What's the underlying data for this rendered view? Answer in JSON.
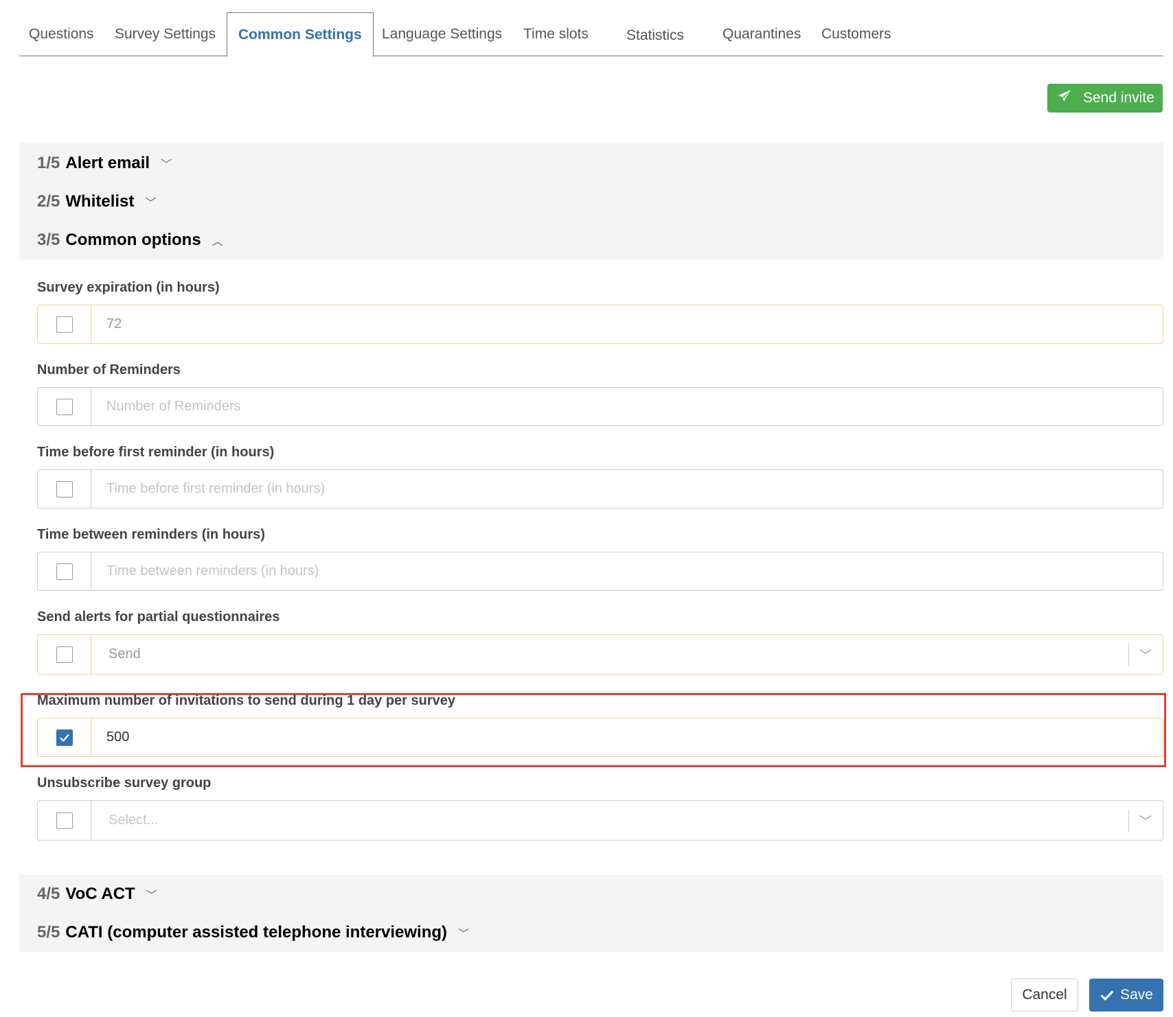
{
  "tabs": [
    {
      "label": "Questions"
    },
    {
      "label": "Survey Settings"
    },
    {
      "label": "Common Settings",
      "active": true
    },
    {
      "label": "Language Settings"
    },
    {
      "label": "Time slots"
    },
    {
      "label": "Statistics"
    },
    {
      "label": "Quarantines"
    },
    {
      "label": "Customers"
    }
  ],
  "send_invite_label": "Send invite",
  "sections": [
    {
      "number": "1/5",
      "title": "Alert email",
      "expanded": false
    },
    {
      "number": "2/5",
      "title": "Whitelist",
      "expanded": false
    },
    {
      "number": "3/5",
      "title": "Common options",
      "expanded": true
    },
    {
      "number": "4/5",
      "title": "VoC ACT",
      "expanded": false
    },
    {
      "number": "5/5",
      "title": "CATI (computer assisted telephone interviewing)",
      "expanded": false
    }
  ],
  "fields": {
    "survey_expiration": {
      "label": "Survey expiration (in hours)",
      "value": "72",
      "checked": false
    },
    "number_of_reminders": {
      "label": "Number of Reminders",
      "placeholder": "Number of Reminders",
      "checked": false
    },
    "time_before_first_reminder": {
      "label": "Time before first reminder (in hours)",
      "placeholder": "Time before first reminder (in hours)",
      "checked": false
    },
    "time_between_reminders": {
      "label": "Time between reminders (in hours)",
      "placeholder": "Time between reminders (in hours)",
      "checked": false
    },
    "send_alerts_partial": {
      "label": "Send alerts for partial questionnaires",
      "value": "Send",
      "checked": false
    },
    "max_invitations_per_day": {
      "label": "Maximum number of invitations to send during 1 day per survey",
      "value": "500",
      "checked": true
    },
    "unsubscribe_survey_group": {
      "label": "Unsubscribe survey group",
      "placeholder": "Select...",
      "checked": false
    }
  },
  "footer": {
    "cancel_label": "Cancel",
    "save_label": "Save"
  },
  "colors": {
    "accent": "#3572b0",
    "success": "#4cae4c",
    "highlight": "#e5412d",
    "warning_border": "#f2d58a"
  }
}
